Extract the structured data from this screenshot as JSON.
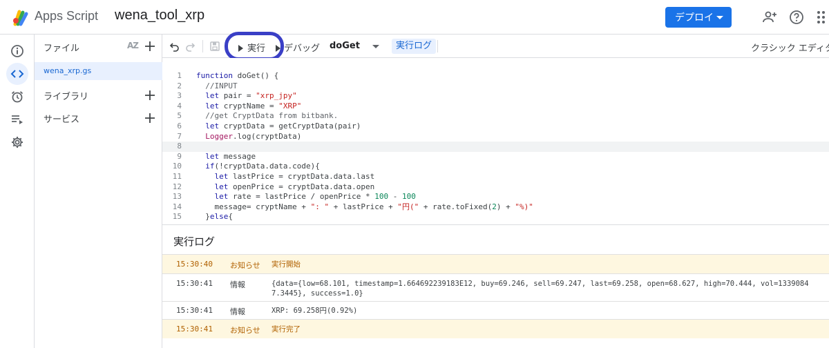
{
  "header": {
    "app_name": "Apps Script",
    "project_title": "wena_tool_xrp",
    "deploy_label": "デプロイ"
  },
  "files_panel": {
    "title": "ファイル",
    "sort_label": "AZ",
    "files": [
      "wena_xrp.gs"
    ],
    "libraries_label": "ライブラリ",
    "services_label": "サービス"
  },
  "toolbar": {
    "run_label": "実行",
    "debug_label": "デバッグ",
    "function_name": "doGet",
    "log_toggle_label": "実行ログ",
    "classic_editor_label": "クラシック エディタを"
  },
  "editor": {
    "lines": [
      "function doGet() {",
      "  //INPUT",
      "  let pair = \"xrp_jpy\"",
      "  let cryptName = \"XRP\"",
      "  //get CryptData from bitbank.",
      "  let cryptData = getCryptData(pair)",
      "  Logger.log(cryptData)",
      "",
      "  let message",
      "  if(!cryptData.data.code){",
      "    let lastPrice = cryptData.data.last",
      "    let openPrice = cryptData.data.open",
      "    let rate = lastPrice / openPrice * 100 - 100",
      "    message= cryptName + \": \" + lastPrice + \"円(\" + rate.toFixed(2) + \"%)\"",
      "  }else{"
    ],
    "current_line": 8
  },
  "log": {
    "title": "実行ログ",
    "entries": [
      {
        "time": "15:30:40",
        "level": "お知らせ",
        "message": "実行開始",
        "kind": "notice"
      },
      {
        "time": "15:30:41",
        "level": "情報",
        "message": "{data={low=68.101, timestamp=1.664692239183E12, buy=69.246, sell=69.247, last=69.258, open=68.627, high=70.444, vol=13390847.3445}, success=1.0}",
        "kind": "info"
      },
      {
        "time": "15:30:41",
        "level": "情報",
        "message": "XRP: 69.258円(0.92%)",
        "kind": "info"
      },
      {
        "time": "15:30:41",
        "level": "お知らせ",
        "message": "実行完了",
        "kind": "notice"
      }
    ]
  },
  "icons": {
    "rail": [
      "info-icon",
      "code-icon",
      "alarm-clock-icon",
      "executions-icon",
      "gear-icon"
    ],
    "header": [
      "add-person-icon",
      "help-icon",
      "apps-grid-icon"
    ]
  },
  "colors": {
    "accent": "#1a73e8",
    "notice_bg": "#fef7e0",
    "notice_text": "#b06000",
    "highlight_ring": "#3a3fc6"
  }
}
